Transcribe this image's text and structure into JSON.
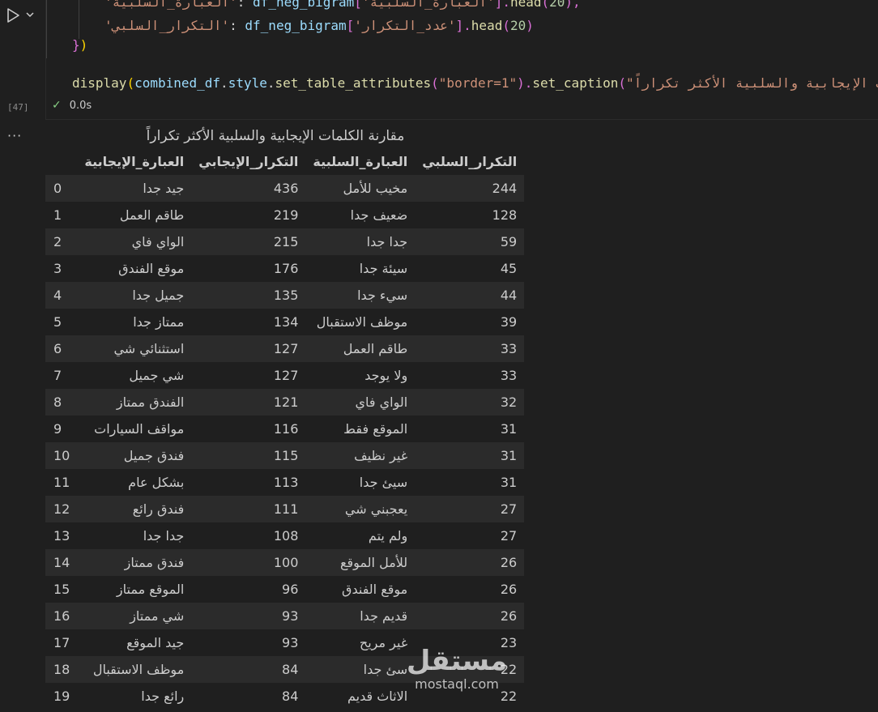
{
  "cell": {
    "exec_count": "[47]",
    "status_time": "0.0s",
    "code": {
      "line1": {
        "s1": "'",
        "s2": "العبارة_السلبية",
        "s3": "'",
        "p1": ": ",
        "v1": "df_neg_bigram",
        "p2": "[",
        "s4": "'العبارة_السلبية'",
        "p3": "].",
        "f1": "head",
        "p4": "(",
        "n1": "20",
        "p5": "),"
      },
      "line2": {
        "s1": "'",
        "s2": "التكرار_السلبي",
        "s3": "'",
        "p1": ": ",
        "v1": "df_neg_bigram",
        "p2": "[",
        "s4": "'عدد_التكرار'",
        "p3": "].",
        "f1": "head",
        "p4": "(",
        "n1": "20",
        "p5": ")"
      },
      "line3": {
        "b1": "}",
        "b2": ")"
      },
      "line5": {
        "f1": "display",
        "p1": "(",
        "v1": "combined_df",
        "p2": ".",
        "v2": "style",
        "p3": ".",
        "f2": "set_table_attributes",
        "p4": "(",
        "s1": "\"border=1\"",
        "p5": ").",
        "f3": "set_caption",
        "p6": "(",
        "s2": "\"مقارنة الكلمات الإيجابية والسلبية الأكثر تكراراً\""
      }
    }
  },
  "output": {
    "caption": "مقارنة الكلمات الإيجابية والسلبية الأكثر تكراراً",
    "headers": {
      "idx": "",
      "pos_phrase": "العبارة_الإيجابية",
      "pos_count": "التكرار_الإيجابي",
      "neg_phrase": "العبارة_السلبية",
      "neg_count": "التكرار_السلبي"
    },
    "rows": [
      {
        "idx": "0",
        "pos_phrase": "جيد جدا",
        "pos_count": "436",
        "neg_phrase": "مخيب للأمل",
        "neg_count": "244"
      },
      {
        "idx": "1",
        "pos_phrase": "طاقم العمل",
        "pos_count": "219",
        "neg_phrase": "ضعيف جدا",
        "neg_count": "128"
      },
      {
        "idx": "2",
        "pos_phrase": "الواي فاي",
        "pos_count": "215",
        "neg_phrase": "جدا جدا",
        "neg_count": "59"
      },
      {
        "idx": "3",
        "pos_phrase": "موقع الفندق",
        "pos_count": "176",
        "neg_phrase": "سيئة جدا",
        "neg_count": "45"
      },
      {
        "idx": "4",
        "pos_phrase": "جميل جدا",
        "pos_count": "135",
        "neg_phrase": "سيء جدا",
        "neg_count": "44"
      },
      {
        "idx": "5",
        "pos_phrase": "ممتاز جدا",
        "pos_count": "134",
        "neg_phrase": "موظف الاستقبال",
        "neg_count": "39"
      },
      {
        "idx": "6",
        "pos_phrase": "استثنائي شي",
        "pos_count": "127",
        "neg_phrase": "طاقم العمل",
        "neg_count": "33"
      },
      {
        "idx": "7",
        "pos_phrase": "شي جميل",
        "pos_count": "127",
        "neg_phrase": "ولا يوجد",
        "neg_count": "33"
      },
      {
        "idx": "8",
        "pos_phrase": "الفندق ممتاز",
        "pos_count": "121",
        "neg_phrase": "الواي فاي",
        "neg_count": "32"
      },
      {
        "idx": "9",
        "pos_phrase": "مواقف السيارات",
        "pos_count": "116",
        "neg_phrase": "الموقع فقط",
        "neg_count": "31"
      },
      {
        "idx": "10",
        "pos_phrase": "فندق جميل",
        "pos_count": "115",
        "neg_phrase": "غير نظيف",
        "neg_count": "31"
      },
      {
        "idx": "11",
        "pos_phrase": "بشكل عام",
        "pos_count": "113",
        "neg_phrase": "سيئ جدا",
        "neg_count": "31"
      },
      {
        "idx": "12",
        "pos_phrase": "فندق رائع",
        "pos_count": "111",
        "neg_phrase": "يعجبني شي",
        "neg_count": "27"
      },
      {
        "idx": "13",
        "pos_phrase": "جدا جدا",
        "pos_count": "108",
        "neg_phrase": "ولم يتم",
        "neg_count": "27"
      },
      {
        "idx": "14",
        "pos_phrase": "فندق ممتاز",
        "pos_count": "100",
        "neg_phrase": "للأمل الموقع",
        "neg_count": "26"
      },
      {
        "idx": "15",
        "pos_phrase": "الموقع ممتاز",
        "pos_count": "96",
        "neg_phrase": "موقع الفندق",
        "neg_count": "26"
      },
      {
        "idx": "16",
        "pos_phrase": "شي ممتاز",
        "pos_count": "93",
        "neg_phrase": "قديم جدا",
        "neg_count": "26"
      },
      {
        "idx": "17",
        "pos_phrase": "جيد الموقع",
        "pos_count": "93",
        "neg_phrase": "غير مريح",
        "neg_count": "23"
      },
      {
        "idx": "18",
        "pos_phrase": "موظف الاستقبال",
        "pos_count": "84",
        "neg_phrase": "سئ جدا",
        "neg_count": "22"
      },
      {
        "idx": "19",
        "pos_phrase": "رائع جدا",
        "pos_count": "84",
        "neg_phrase": "الاثاث قديم",
        "neg_count": "22"
      }
    ]
  },
  "watermark": {
    "arabic": "مستقل",
    "latin": "mostaql.com"
  },
  "icons": {
    "run": "play-icon",
    "expand": "chevron-down-icon",
    "status": "check-icon",
    "more": "ellipsis-icon"
  }
}
